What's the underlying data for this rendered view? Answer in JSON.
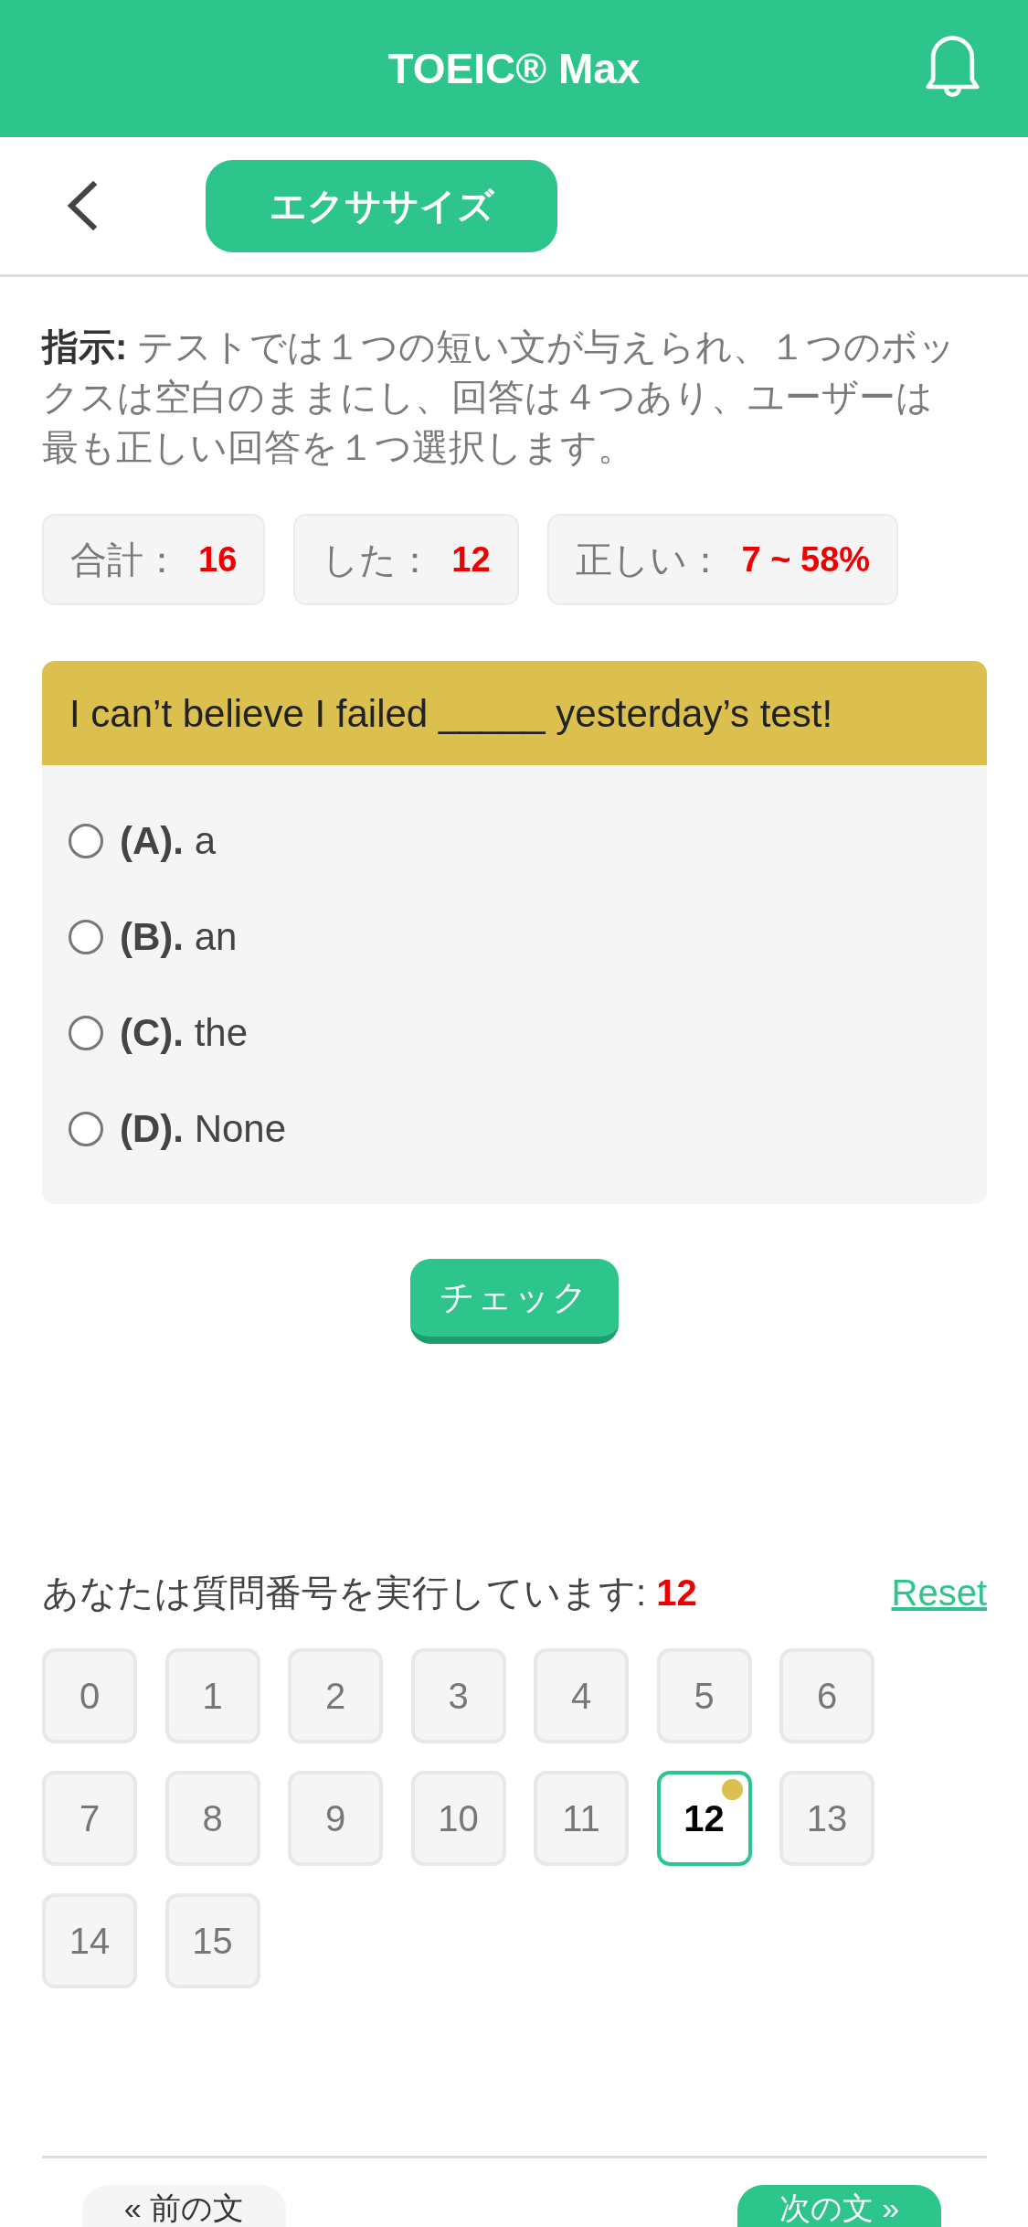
{
  "header": {
    "title": "TOEIC® Max"
  },
  "toolbar": {
    "tab": "エクササイズ"
  },
  "instruction": "**指示:** テストでは１つの短い文が与えられ、１つのボックスは空白のままにし、回答は４つあり、ユーザーは最も正しい回答を１つ選択します。",
  "stats": [
    {
      "label": "合計：",
      "value": "16"
    },
    {
      "label": "した：",
      "value": "12"
    },
    {
      "label": "正しい：",
      "value": "7 ~ 58%"
    }
  ],
  "question": {
    "text": "I can’t believe I failed _____ yesterday’s test!",
    "options": [
      {
        "letter": "(A).",
        "text": "a",
        "selected": false
      },
      {
        "letter": "(B).",
        "text": "an",
        "selected": false
      },
      {
        "letter": "(C).",
        "text": "the",
        "selected": false
      },
      {
        "letter": "(D).",
        "text": "None",
        "selected": false
      }
    ]
  },
  "check_button": "チェック",
  "progress": {
    "label": "あなたは質問番号を実行しています:",
    "current": "12",
    "reset": "Reset"
  },
  "questions": [
    {
      "label": "0",
      "selected": false
    },
    {
      "label": "1",
      "selected": false
    },
    {
      "label": "2",
      "selected": false
    },
    {
      "label": "3",
      "selected": false
    },
    {
      "label": "4",
      "selected": false
    },
    {
      "label": "5",
      "selected": false
    },
    {
      "label": "6",
      "selected": false
    },
    {
      "label": "7",
      "selected": false
    },
    {
      "label": "8",
      "selected": false
    },
    {
      "label": "9",
      "selected": false
    },
    {
      "label": "10",
      "selected": false
    },
    {
      "label": "11",
      "selected": false
    },
    {
      "label": "12",
      "selected": true
    },
    {
      "label": "13",
      "selected": false
    },
    {
      "label": "14",
      "selected": false
    },
    {
      "label": "15",
      "selected": false
    }
  ],
  "navigation": {
    "previous": "« 前の文",
    "next": "次の文 »"
  }
}
